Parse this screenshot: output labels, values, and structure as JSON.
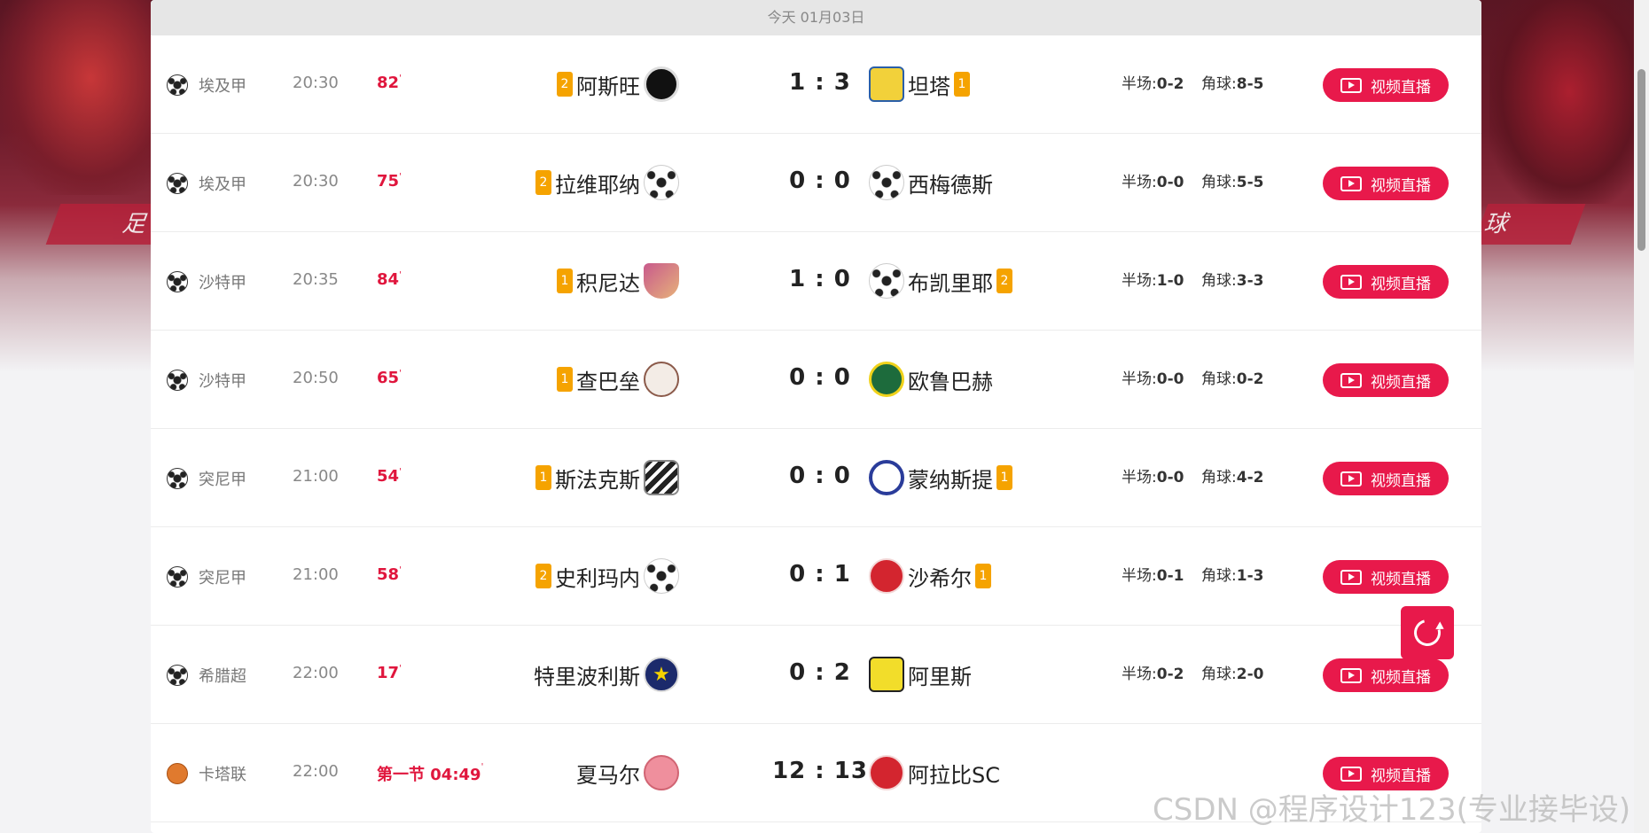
{
  "date_header": "今天 01月03日",
  "live_label": "视频直播",
  "watermark": "CSDN @程序设计123(专业接毕设)",
  "matches": [
    {
      "sport": "soccer-icon",
      "league": "埃及甲",
      "time": "20:30",
      "minute": "82",
      "home": "阿斯旺",
      "home_badge": "2",
      "home_logo": "black",
      "score": "1 : 3",
      "away": "坦塔",
      "away_badge": "1",
      "away_logo": "gold",
      "half_label": "半场:",
      "half": "0-2",
      "corner_label": "角球:",
      "corner": "8-5"
    },
    {
      "sport": "soccer-icon",
      "league": "埃及甲",
      "time": "20:30",
      "minute": "75",
      "home": "拉维耶纳",
      "home_badge": "2",
      "home_logo": "ball",
      "score": "0 : 0",
      "away": "西梅德斯",
      "away_badge": "",
      "away_logo": "ball",
      "half_label": "半场:",
      "half": "0-0",
      "corner_label": "角球:",
      "corner": "5-5"
    },
    {
      "sport": "soccer-icon",
      "league": "沙特甲",
      "time": "20:35",
      "minute": "84",
      "home": "积尼达",
      "home_badge": "1",
      "home_logo": "purple",
      "score": "1 : 0",
      "away": "布凯里耶",
      "away_badge": "2",
      "away_logo": "ball",
      "half_label": "半场:",
      "half": "1-0",
      "corner_label": "角球:",
      "corner": "3-3"
    },
    {
      "sport": "soccer-icon",
      "league": "沙特甲",
      "time": "20:50",
      "minute": "65",
      "home": "查巴垒",
      "home_badge": "1",
      "home_logo": "brown",
      "score": "0 : 0",
      "away": "欧鲁巴赫",
      "away_badge": "",
      "away_logo": "green",
      "half_label": "半场:",
      "half": "0-0",
      "corner_label": "角球:",
      "corner": "0-2"
    },
    {
      "sport": "soccer-icon",
      "league": "突尼甲",
      "time": "21:00",
      "minute": "54",
      "home": "斯法克斯",
      "home_badge": "1",
      "home_logo": "stripe",
      "score": "0 : 0",
      "away": "蒙纳斯提",
      "away_badge": "1",
      "away_logo": "navy",
      "half_label": "半场:",
      "half": "0-0",
      "corner_label": "角球:",
      "corner": "4-2"
    },
    {
      "sport": "soccer-icon",
      "league": "突尼甲",
      "time": "21:00",
      "minute": "58",
      "home": "史利玛内",
      "home_badge": "2",
      "home_logo": "ball",
      "score": "0 : 1",
      "away": "沙希尔",
      "away_badge": "1",
      "away_logo": "red",
      "half_label": "半场:",
      "half": "0-1",
      "corner_label": "角球:",
      "corner": "1-3"
    },
    {
      "sport": "soccer-icon",
      "league": "希腊超",
      "time": "22:00",
      "minute": "17",
      "home": "特里波利斯",
      "home_badge": "",
      "home_logo": "star",
      "score": "0 : 2",
      "away": "阿里斯",
      "away_badge": "",
      "away_logo": "yellow",
      "half_label": "半场:",
      "half": "0-2",
      "corner_label": "角球:",
      "corner": "2-0"
    },
    {
      "sport": "basketball-icon",
      "league": "卡塔联",
      "time": "22:00",
      "minute": "第一节 04:49",
      "home": "夏马尔",
      "home_badge": "",
      "home_logo": "pink",
      "score": "12 : 13",
      "away": "阿拉比SC",
      "away_badge": "",
      "away_logo": "red",
      "half_label": "",
      "half": "",
      "corner_label": "",
      "corner": ""
    }
  ]
}
